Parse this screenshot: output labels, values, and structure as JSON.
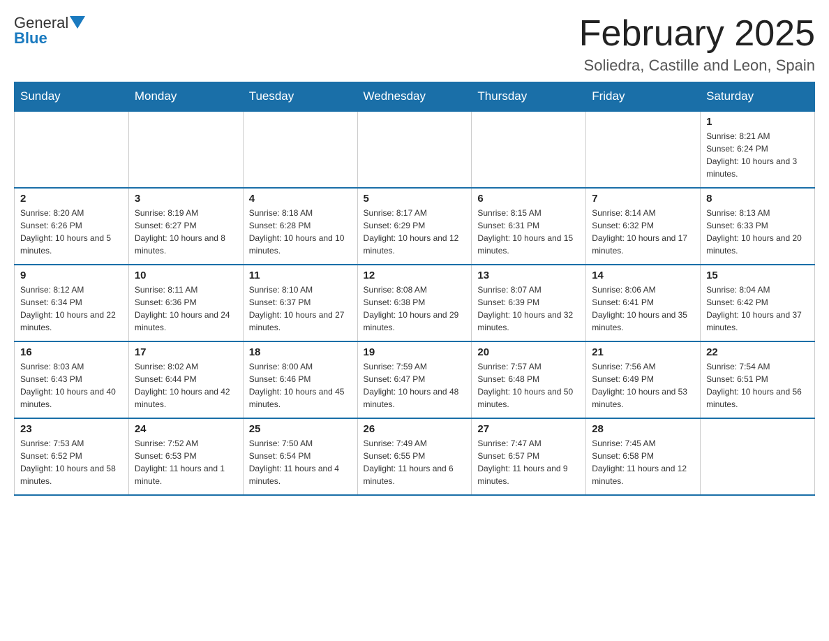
{
  "header": {
    "logo": {
      "text_general": "General",
      "text_blue": "Blue"
    },
    "title": "February 2025",
    "subtitle": "Soliedra, Castille and Leon, Spain"
  },
  "days_of_week": [
    "Sunday",
    "Monday",
    "Tuesday",
    "Wednesday",
    "Thursday",
    "Friday",
    "Saturday"
  ],
  "weeks": [
    [
      {
        "day": "",
        "info": ""
      },
      {
        "day": "",
        "info": ""
      },
      {
        "day": "",
        "info": ""
      },
      {
        "day": "",
        "info": ""
      },
      {
        "day": "",
        "info": ""
      },
      {
        "day": "",
        "info": ""
      },
      {
        "day": "1",
        "info": "Sunrise: 8:21 AM\nSunset: 6:24 PM\nDaylight: 10 hours and 3 minutes."
      }
    ],
    [
      {
        "day": "2",
        "info": "Sunrise: 8:20 AM\nSunset: 6:26 PM\nDaylight: 10 hours and 5 minutes."
      },
      {
        "day": "3",
        "info": "Sunrise: 8:19 AM\nSunset: 6:27 PM\nDaylight: 10 hours and 8 minutes."
      },
      {
        "day": "4",
        "info": "Sunrise: 8:18 AM\nSunset: 6:28 PM\nDaylight: 10 hours and 10 minutes."
      },
      {
        "day": "5",
        "info": "Sunrise: 8:17 AM\nSunset: 6:29 PM\nDaylight: 10 hours and 12 minutes."
      },
      {
        "day": "6",
        "info": "Sunrise: 8:15 AM\nSunset: 6:31 PM\nDaylight: 10 hours and 15 minutes."
      },
      {
        "day": "7",
        "info": "Sunrise: 8:14 AM\nSunset: 6:32 PM\nDaylight: 10 hours and 17 minutes."
      },
      {
        "day": "8",
        "info": "Sunrise: 8:13 AM\nSunset: 6:33 PM\nDaylight: 10 hours and 20 minutes."
      }
    ],
    [
      {
        "day": "9",
        "info": "Sunrise: 8:12 AM\nSunset: 6:34 PM\nDaylight: 10 hours and 22 minutes."
      },
      {
        "day": "10",
        "info": "Sunrise: 8:11 AM\nSunset: 6:36 PM\nDaylight: 10 hours and 24 minutes."
      },
      {
        "day": "11",
        "info": "Sunrise: 8:10 AM\nSunset: 6:37 PM\nDaylight: 10 hours and 27 minutes."
      },
      {
        "day": "12",
        "info": "Sunrise: 8:08 AM\nSunset: 6:38 PM\nDaylight: 10 hours and 29 minutes."
      },
      {
        "day": "13",
        "info": "Sunrise: 8:07 AM\nSunset: 6:39 PM\nDaylight: 10 hours and 32 minutes."
      },
      {
        "day": "14",
        "info": "Sunrise: 8:06 AM\nSunset: 6:41 PM\nDaylight: 10 hours and 35 minutes."
      },
      {
        "day": "15",
        "info": "Sunrise: 8:04 AM\nSunset: 6:42 PM\nDaylight: 10 hours and 37 minutes."
      }
    ],
    [
      {
        "day": "16",
        "info": "Sunrise: 8:03 AM\nSunset: 6:43 PM\nDaylight: 10 hours and 40 minutes."
      },
      {
        "day": "17",
        "info": "Sunrise: 8:02 AM\nSunset: 6:44 PM\nDaylight: 10 hours and 42 minutes."
      },
      {
        "day": "18",
        "info": "Sunrise: 8:00 AM\nSunset: 6:46 PM\nDaylight: 10 hours and 45 minutes."
      },
      {
        "day": "19",
        "info": "Sunrise: 7:59 AM\nSunset: 6:47 PM\nDaylight: 10 hours and 48 minutes."
      },
      {
        "day": "20",
        "info": "Sunrise: 7:57 AM\nSunset: 6:48 PM\nDaylight: 10 hours and 50 minutes."
      },
      {
        "day": "21",
        "info": "Sunrise: 7:56 AM\nSunset: 6:49 PM\nDaylight: 10 hours and 53 minutes."
      },
      {
        "day": "22",
        "info": "Sunrise: 7:54 AM\nSunset: 6:51 PM\nDaylight: 10 hours and 56 minutes."
      }
    ],
    [
      {
        "day": "23",
        "info": "Sunrise: 7:53 AM\nSunset: 6:52 PM\nDaylight: 10 hours and 58 minutes."
      },
      {
        "day": "24",
        "info": "Sunrise: 7:52 AM\nSunset: 6:53 PM\nDaylight: 11 hours and 1 minute."
      },
      {
        "day": "25",
        "info": "Sunrise: 7:50 AM\nSunset: 6:54 PM\nDaylight: 11 hours and 4 minutes."
      },
      {
        "day": "26",
        "info": "Sunrise: 7:49 AM\nSunset: 6:55 PM\nDaylight: 11 hours and 6 minutes."
      },
      {
        "day": "27",
        "info": "Sunrise: 7:47 AM\nSunset: 6:57 PM\nDaylight: 11 hours and 9 minutes."
      },
      {
        "day": "28",
        "info": "Sunrise: 7:45 AM\nSunset: 6:58 PM\nDaylight: 11 hours and 12 minutes."
      },
      {
        "day": "",
        "info": ""
      }
    ]
  ]
}
